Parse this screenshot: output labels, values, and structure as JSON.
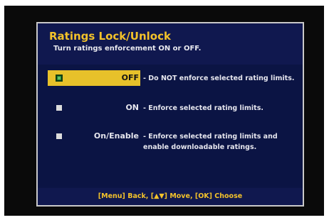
{
  "dialog": {
    "title": "Ratings Lock/Unlock",
    "subtitle": "Turn ratings enforcement ON or OFF."
  },
  "options": [
    {
      "label": "OFF",
      "description": "- Do NOT enforce selected rating limits.",
      "selected": true
    },
    {
      "label": "ON",
      "description": "- Enforce selected rating limits.",
      "selected": false
    },
    {
      "label": "On/Enable",
      "description": "- Enforce selected rating limits and enable downloadable ratings.",
      "selected": false
    }
  ],
  "footer": {
    "hint": "[Menu] Back, [▲▼] Move, [OK] Choose"
  },
  "colors": {
    "accent": "#e7c12a",
    "title": "#f3c22a",
    "background": "#0c1546"
  }
}
